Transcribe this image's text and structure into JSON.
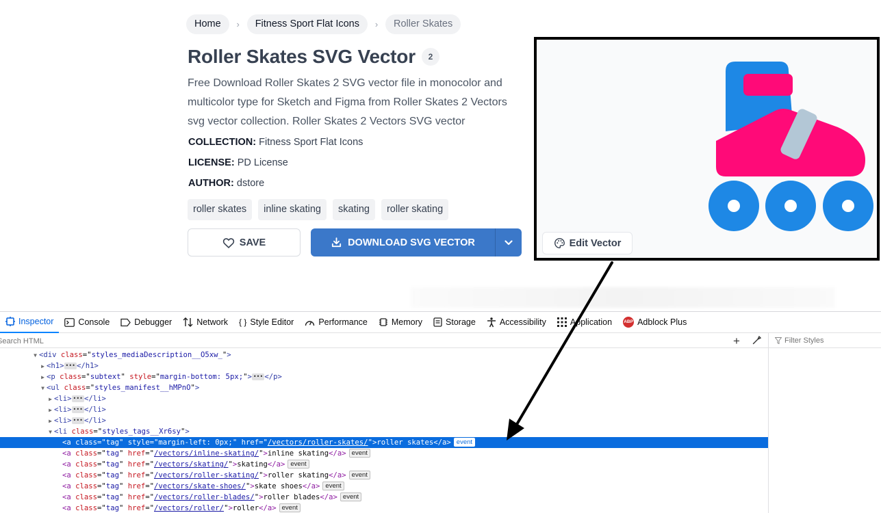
{
  "breadcrumb": {
    "items": [
      "Home",
      "Fitness Sport Flat Icons",
      "Roller Skates"
    ],
    "separator": "›"
  },
  "header": {
    "title": "Roller Skates SVG Vector",
    "badge": "2"
  },
  "description": "Free Download Roller Skates 2 SVG vector file in monocolor and multicolor type for Sketch and Figma from Roller Skates 2 Vectors svg vector collection. Roller Skates 2 Vectors SVG vector",
  "meta": {
    "collection_label": "COLLECTION:",
    "collection_value": "Fitness Sport Flat Icons",
    "license_label": "LICENSE:",
    "license_value": "PD License",
    "author_label": "AUTHOR:",
    "author_value": "dstore"
  },
  "tags": [
    "roller skates",
    "inline skating",
    "skating",
    "roller skating"
  ],
  "actions": {
    "save_label": "SAVE",
    "download_label": "DOWNLOAD SVG VECTOR",
    "edit_label": "Edit Vector"
  },
  "colors": {
    "download_bg": "#3b78c9",
    "boot_top": "#1e88e5",
    "boot_pink": "#ff0a78",
    "strap": "#b3c7d6",
    "devtools_selected": "#0a6cde"
  },
  "devtools": {
    "tabs": [
      {
        "label": "Inspector",
        "icon": "inspector-icon"
      },
      {
        "label": "Console",
        "icon": "console-icon"
      },
      {
        "label": "Debugger",
        "icon": "debugger-icon"
      },
      {
        "label": "Network",
        "icon": "network-icon"
      },
      {
        "label": "Style Editor",
        "icon": "style-editor-icon"
      },
      {
        "label": "Performance",
        "icon": "performance-icon"
      },
      {
        "label": "Memory",
        "icon": "memory-icon"
      },
      {
        "label": "Storage",
        "icon": "storage-icon"
      },
      {
        "label": "Accessibility",
        "icon": "accessibility-icon"
      },
      {
        "label": "Application",
        "icon": "application-icon"
      },
      {
        "label": "Adblock Plus",
        "icon": "adblock-plus-icon"
      }
    ],
    "abp_icon_text": "ABP",
    "search_placeholder": "Search HTML",
    "filter_placeholder": "Filter Styles",
    "tree": {
      "div_class": "styles_mediaDescription__O5xw_",
      "p_class": "subtext",
      "p_style": "margin-bottom: 5px;",
      "ul_class": "styles_manifest__hMPnO",
      "li_class": "styles_tags__Xr6sy",
      "event_badge": "event",
      "links": [
        {
          "href": "/vectors/roller-skates/",
          "text": "roller skates",
          "style": "margin-left: 0px;"
        },
        {
          "href": "/vectors/inline-skating/",
          "text": "inline skating"
        },
        {
          "href": "/vectors/skating/",
          "text": "skating"
        },
        {
          "href": "/vectors/roller-skating/",
          "text": "roller skating"
        },
        {
          "href": "/vectors/skate-shoes/",
          "text": "skate shoes"
        },
        {
          "href": "/vectors/roller-blades/",
          "text": "roller blades"
        },
        {
          "href": "/vectors/roller/",
          "text": "roller"
        }
      ]
    }
  }
}
